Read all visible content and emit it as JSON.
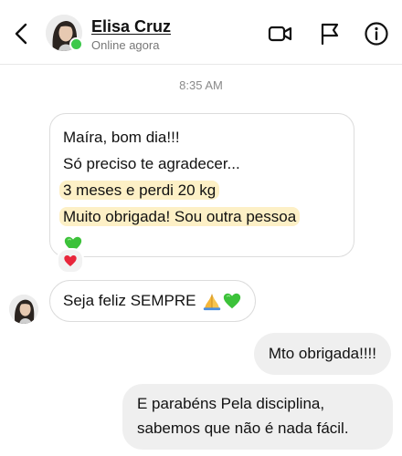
{
  "header": {
    "contact_name": "Elisa Cruz",
    "status": "Online agora",
    "icons": {
      "back": "chevron-left-icon",
      "video": "video-camera-icon",
      "report": "flag-icon",
      "info": "info-icon"
    },
    "online_color": "#3cc84a"
  },
  "timestamp": "8:35 AM",
  "messages": {
    "received_1": {
      "line_1": "Maíra, bom dia!!!",
      "line_2": "Só preciso te agradecer...",
      "line_3": "3 meses e perdi 20 kg",
      "line_4": "Muito obrigada! Sou outra pessoa",
      "emoji": "green-heart",
      "highlight_color": "#fdf0c6",
      "reaction": "red-heart"
    },
    "received_2": {
      "text": "Seja feliz SEMPRE",
      "emojis": [
        "folded-hands",
        "green-heart"
      ]
    },
    "sent_1": {
      "text": "Mto obrigada!!!!"
    },
    "sent_2": {
      "line_1": "E parabéns Pela disciplina,",
      "line_2": "sabemos que não é nada fácil."
    }
  },
  "colors": {
    "sent_bubble": "#efefef",
    "received_border": "#dcdcdc",
    "heart_red": "#e8263b",
    "heart_green": "#3cc23a"
  }
}
